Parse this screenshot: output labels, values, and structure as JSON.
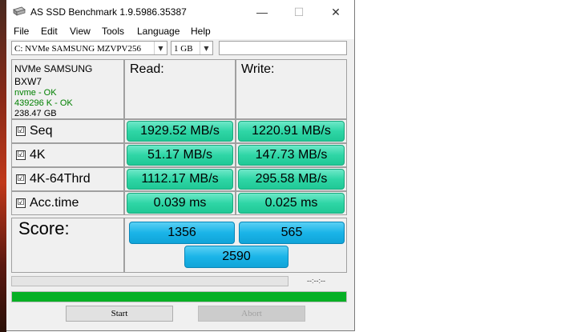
{
  "window": {
    "title": "AS SSD Benchmark 1.9.5986.35387"
  },
  "menu": [
    "File",
    "Edit",
    "View",
    "Tools",
    "Language",
    "Help"
  ],
  "toolbar": {
    "drive": "C: NVMe SAMSUNG MZVPV256",
    "size": "1 GB",
    "text_value": ""
  },
  "drive_info": {
    "model": "NVMe SAMSUNG",
    "firmware": "BXW7",
    "driver_status": "nvme - OK",
    "alignment_status": "439296 K - OK",
    "capacity": "238.47 GB"
  },
  "columns": {
    "read": "Read:",
    "write": "Write:"
  },
  "rows": [
    {
      "label": "Seq",
      "checked": true,
      "read": "1929.52 MB/s",
      "write": "1220.91 MB/s"
    },
    {
      "label": "4K",
      "checked": true,
      "read": "51.17 MB/s",
      "write": "147.73 MB/s"
    },
    {
      "label": "4K-64Thrd",
      "checked": true,
      "read": "1112.17 MB/s",
      "write": "295.58 MB/s"
    },
    {
      "label": "Acc.time",
      "checked": true,
      "read": "0.039 ms",
      "write": "0.025 ms"
    }
  ],
  "score": {
    "label": "Score:",
    "read": "1356",
    "write": "565",
    "total": "2590"
  },
  "progress": {
    "timer": "--:--:--",
    "top_fraction": 0.0,
    "bottom_fraction": 1.0
  },
  "buttons": {
    "start": "Start",
    "abort": "Abort"
  },
  "checkmark": "☑",
  "colors": {
    "ok_text": "#008000",
    "result_green": "#2fd6a6",
    "score_blue": "#1ab4e8",
    "progress_green": "#06b025"
  }
}
